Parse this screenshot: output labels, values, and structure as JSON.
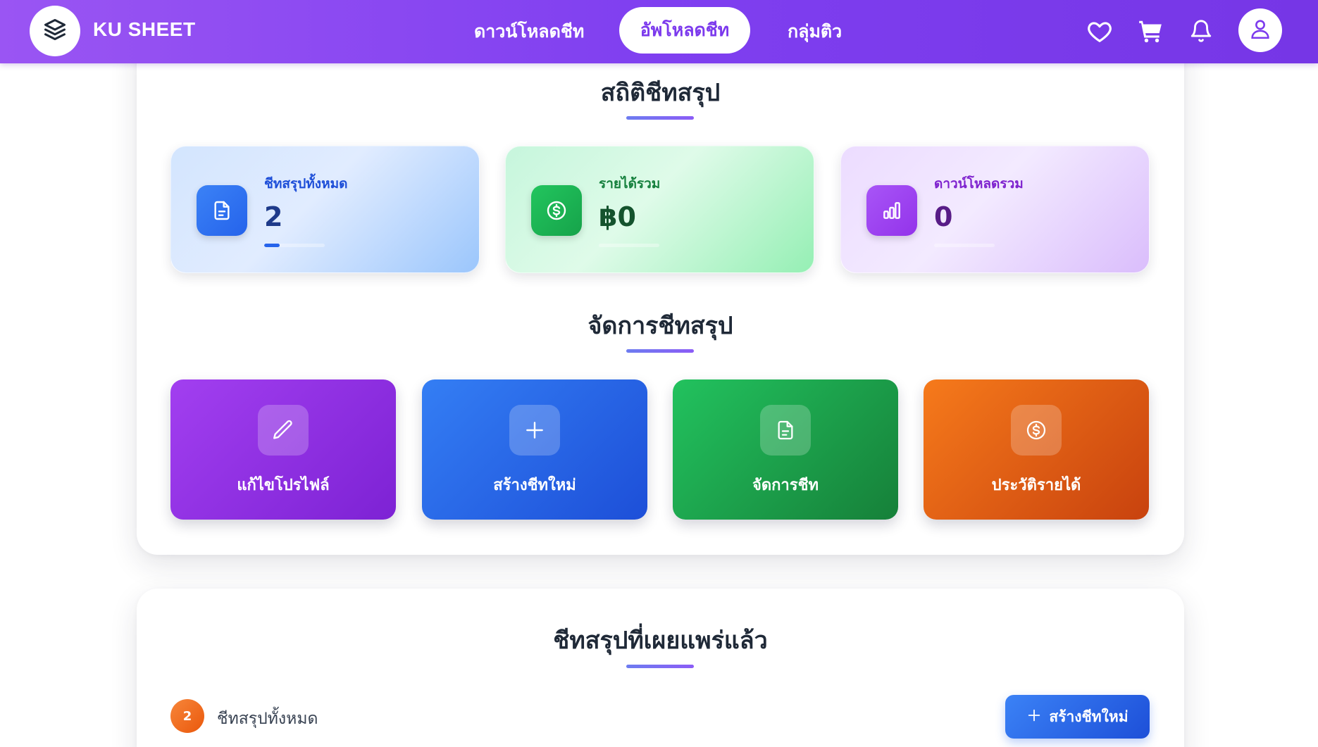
{
  "nav": {
    "brand": "KU SHEET",
    "links": [
      "ดาวน์โหลดชีท",
      "อัพโหลดชีท",
      "กลุ่มติว"
    ],
    "active_index": 1
  },
  "stats_section": {
    "title": "สถิติชีทสรุป",
    "cards": [
      {
        "label": "ชีทสรุปทั้งหมด",
        "value": "2",
        "icon": "file-icon",
        "progress": 0.25
      },
      {
        "label": "รายได้รวม",
        "value": "฿0",
        "icon": "dollar-icon",
        "progress": 0
      },
      {
        "label": "ดาวน์โหลดรวม",
        "value": "0",
        "icon": "bar-chart-icon",
        "progress": 0
      }
    ]
  },
  "manage_section": {
    "title": "จัดการชีทสรุป",
    "actions": [
      {
        "label": "แก้ไขโปรไฟล์",
        "icon": "pencil-icon"
      },
      {
        "label": "สร้างชีทใหม่",
        "icon": "plus-icon"
      },
      {
        "label": "จัดการชีท",
        "icon": "file-icon"
      },
      {
        "label": "ประวัติรายได้",
        "icon": "dollar-icon"
      }
    ]
  },
  "published_section": {
    "title": "ชีทสรุปที่เผยแพร่แล้ว",
    "count": "2",
    "count_label": "ชีทสรุปทั้งหมด",
    "create_button": "สร้างชีทใหม่"
  },
  "colors": {
    "nav_start": "#9a55f3",
    "nav_end": "#7636e6",
    "blue": "#2f6fec",
    "green": "#16a34a",
    "purple": "#9333ea",
    "orange": "#ea580c"
  }
}
